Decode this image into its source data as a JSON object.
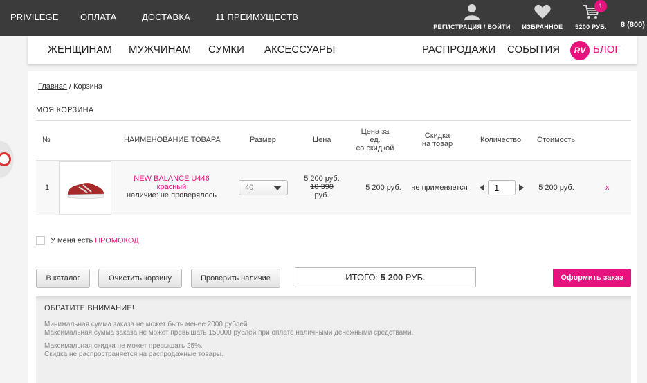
{
  "topbar": {
    "nav": [
      "PRIVILEGE",
      "ОПЛАТА",
      "ДОСТАВКА",
      "11 ПРЕИМУЩЕСТВ"
    ],
    "account_label": "РЕГИСТРАЦИЯ / ВОЙТИ",
    "favorites_label": "ИЗБРАННОЕ",
    "cart_label": "5200 РУБ.",
    "cart_badge": "1",
    "phone": "8 (800)"
  },
  "mainnav": {
    "left": [
      "ЖЕНЩИНАМ",
      "МУЖЧИНАМ",
      "СУМКИ",
      "АКСЕССУАРЫ"
    ],
    "right": [
      "РАСПРОДАЖИ",
      "СОБЫТИЯ"
    ],
    "logo_text": "RV",
    "blog": "БЛОГ"
  },
  "breadcrumb": {
    "home": "Главная",
    "separator": " / ",
    "current": "Корзина"
  },
  "cart_title": "МОЯ КОРЗИНА",
  "columns": [
    "№",
    "НАИМЕНОВАНИЕ ТОВАРА",
    "Размер",
    "Цена",
    "Цена за",
    "ед.",
    "со скидкой",
    "Скидка",
    "на товар",
    "Количество",
    "Стоимость"
  ],
  "item": {
    "number": "1",
    "name": "NEW BALANCE U446",
    "color": "красный",
    "availability": "наличие: не проверялось",
    "size": "40",
    "price": "5 200 руб.",
    "old_price": "10 390",
    "old_price_unit": "руб.",
    "discount_price": "5 200 руб.",
    "discount": "не применяется",
    "quantity": "1",
    "total": "5 200 руб.",
    "remove": "x"
  },
  "promo": {
    "text": "У меня есть ",
    "link": "ПРОМОКОД"
  },
  "buttons": {
    "catalog": "В каталог",
    "clear": "Очистить корзину",
    "check": "Проверить наличие",
    "order": "Оформить заказ"
  },
  "total": {
    "label": "ИТОГО: ",
    "amount": "5 200",
    "unit": " РУБ."
  },
  "notice": {
    "title": "ОБРАТИТЕ ВНИМАНИЕ!",
    "lines": [
      "Минимальная сумма заказа не может быть менее 2000 рублей.",
      "Максимальная сумма заказа не может превышать 150000 рублей при оплате наличными денежными средствами.",
      "Максимальная скидка не может превышать 25%.",
      "Скидка не распространяется на распродажные товары."
    ]
  },
  "colors": {
    "accent": "#e6137f",
    "topbar": "#3b3b3b"
  },
  "icons": [
    "user-icon",
    "heart-icon",
    "cart-icon",
    "chevron-down-icon",
    "arrow-left-icon",
    "arrow-right-icon"
  ]
}
